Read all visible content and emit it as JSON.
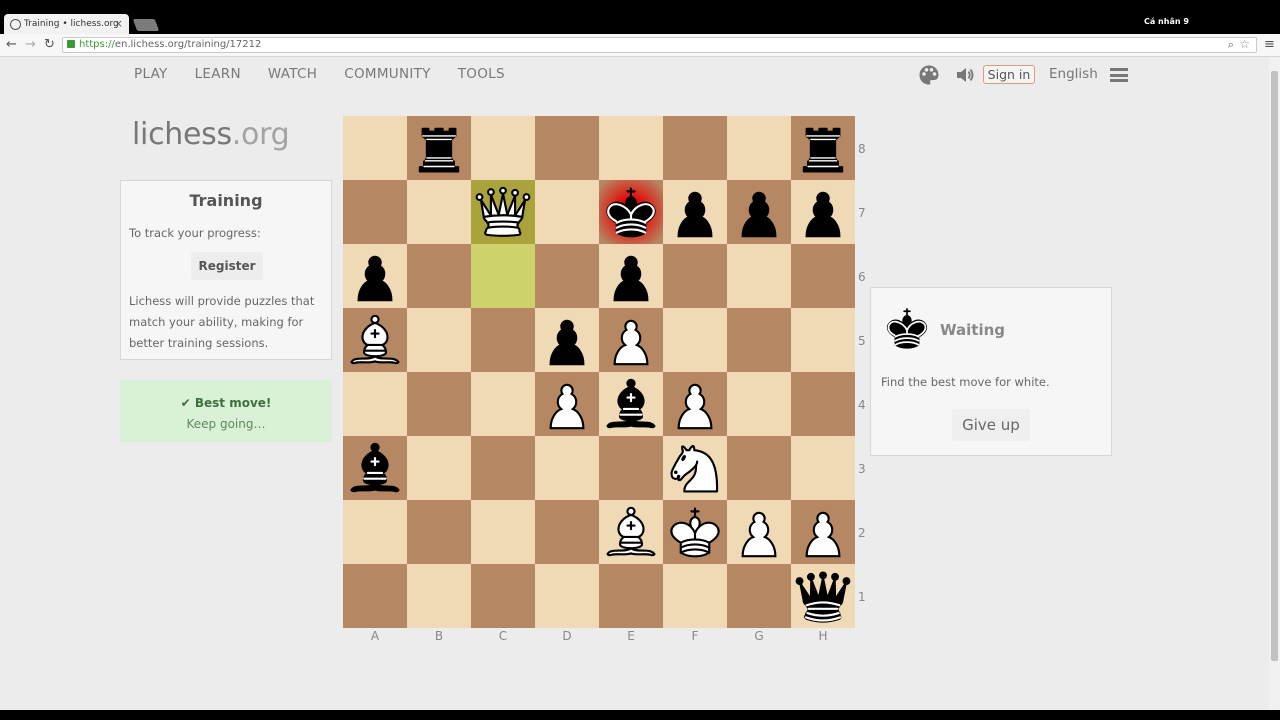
{
  "browser": {
    "tab_title": "Training • lichess.org",
    "tab_close": "×",
    "profile": "Cá nhân 9",
    "url_scheme": "https://",
    "url_rest": "en.lichess.org/training/17212"
  },
  "nav": {
    "items": [
      "PLAY",
      "LEARN",
      "WATCH",
      "COMMUNITY",
      "TOOLS"
    ],
    "sign_in": "Sign in",
    "language": "English"
  },
  "logo": {
    "main": "lichess",
    "tld": ".org"
  },
  "training": {
    "title": "Training",
    "track": "To track your progress:",
    "register": "Register",
    "description": "Lichess will provide puzzles that match your ability, making for better training sessions."
  },
  "feedback": {
    "check_mark": "✔",
    "best": "Best move!",
    "keep": "Keep going…"
  },
  "board": {
    "files": [
      "A",
      "B",
      "C",
      "D",
      "E",
      "F",
      "G",
      "H"
    ],
    "ranks": [
      "8",
      "7",
      "6",
      "5",
      "4",
      "3",
      "2",
      "1"
    ],
    "pieces": [
      {
        "square": "b8",
        "piece": "r"
      },
      {
        "square": "h8",
        "piece": "r"
      },
      {
        "square": "c7",
        "piece": "Q"
      },
      {
        "square": "e7",
        "piece": "k"
      },
      {
        "square": "f7",
        "piece": "p"
      },
      {
        "square": "g7",
        "piece": "p"
      },
      {
        "square": "h7",
        "piece": "p"
      },
      {
        "square": "a6",
        "piece": "p"
      },
      {
        "square": "e6",
        "piece": "p"
      },
      {
        "square": "a5",
        "piece": "B"
      },
      {
        "square": "d5",
        "piece": "p"
      },
      {
        "square": "e5",
        "piece": "P"
      },
      {
        "square": "d4",
        "piece": "P"
      },
      {
        "square": "e4",
        "piece": "b"
      },
      {
        "square": "f4",
        "piece": "P"
      },
      {
        "square": "a3",
        "piece": "b"
      },
      {
        "square": "f3",
        "piece": "N"
      },
      {
        "square": "e2",
        "piece": "B"
      },
      {
        "square": "f2",
        "piece": "K"
      },
      {
        "square": "g2",
        "piece": "P"
      },
      {
        "square": "h2",
        "piece": "P"
      },
      {
        "square": "h1",
        "piece": "q"
      }
    ],
    "last_move": [
      "c6",
      "c7"
    ],
    "check_square": "e7"
  },
  "puzzle": {
    "status": "Waiting",
    "instruction": "Find the best move for white.",
    "give_up": "Give up"
  },
  "colors": {
    "light_square": "#f0d9b5",
    "dark_square": "#b58863",
    "success_bg": "#d9f1d6",
    "signin_border": "#e09a78"
  }
}
